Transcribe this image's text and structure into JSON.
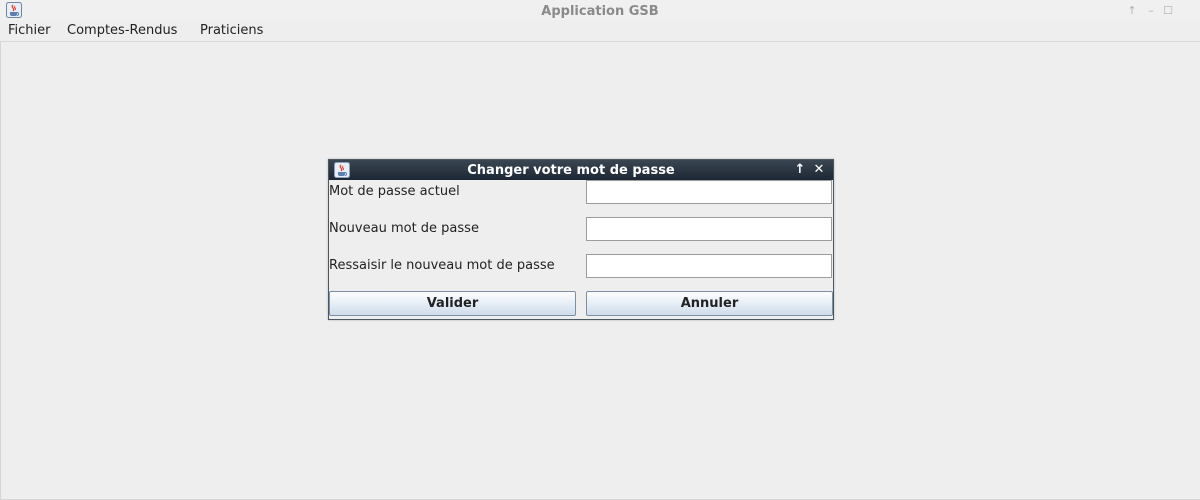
{
  "window": {
    "title": "Application GSB",
    "controls": {
      "upload": "↑",
      "minimize": "–",
      "maximize": "☐"
    }
  },
  "menubar": {
    "items": [
      {
        "label": "Fichier"
      },
      {
        "label": "Comptes-Rendus"
      },
      {
        "label": "Praticiens"
      }
    ]
  },
  "dialog": {
    "title": "Changer votre mot de passe",
    "controls": {
      "upload": "↑",
      "close": "✕"
    },
    "fields": [
      {
        "label": "Mot de passe actuel",
        "value": ""
      },
      {
        "label": "Nouveau mot de passe",
        "value": ""
      },
      {
        "label": "Ressaisir le nouveau mot de passe",
        "value": ""
      }
    ],
    "buttons": {
      "submit": "Valider",
      "cancel": "Annuler"
    }
  },
  "colors": {
    "background": "#eeeeee",
    "dialog_titlebar": "#1c2733",
    "button_border": "#7b8fa5"
  }
}
